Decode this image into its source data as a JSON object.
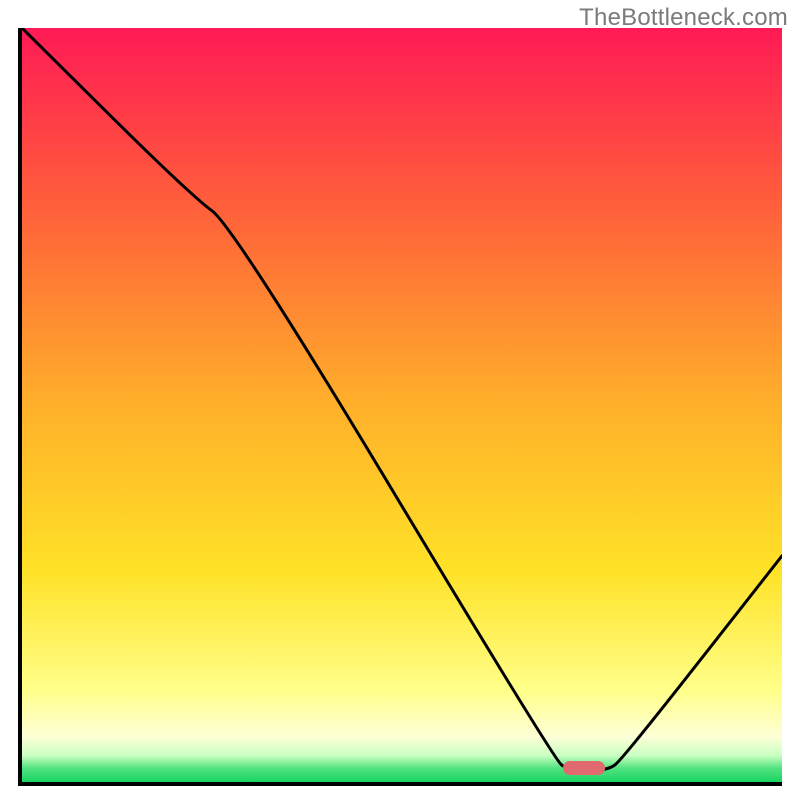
{
  "watermark": {
    "text": "TheBottleneck.com"
  },
  "chart_data": {
    "type": "line",
    "title": "",
    "xlabel": "",
    "ylabel": "",
    "x_range": [
      0,
      100
    ],
    "y_range": [
      0,
      100
    ],
    "gradient_note": "y=100 red, y≈50 orange, y≈15 yellow→pale, y≈2 to 0 green",
    "gradient_stops": [
      {
        "y_pct_from_top": 0,
        "color": "#ff1a55"
      },
      {
        "y_pct_from_top": 22,
        "color": "#ff5a3c"
      },
      {
        "y_pct_from_top": 50,
        "color": "#ffb02a"
      },
      {
        "y_pct_from_top": 72,
        "color": "#ffe227"
      },
      {
        "y_pct_from_top": 88,
        "color": "#ffff8a"
      },
      {
        "y_pct_from_top": 94,
        "color": "#fdffd6"
      },
      {
        "y_pct_from_top": 96.5,
        "color": "#c9ffc2"
      },
      {
        "y_pct_from_top": 98.2,
        "color": "#51e27e"
      },
      {
        "y_pct_from_top": 100,
        "color": "#18d463"
      }
    ],
    "curve_points_xy": [
      [
        0,
        100
      ],
      [
        22,
        78
      ],
      [
        28,
        73.5
      ],
      [
        70,
        3
      ],
      [
        72,
        1.5
      ],
      [
        77,
        1.5
      ],
      [
        79,
        3
      ],
      [
        100,
        30
      ]
    ],
    "marker": {
      "x_center": 74,
      "y_center": 1.9,
      "shape": "pill",
      "color": "#e06a6f",
      "note": "flat bottom highlight"
    }
  }
}
